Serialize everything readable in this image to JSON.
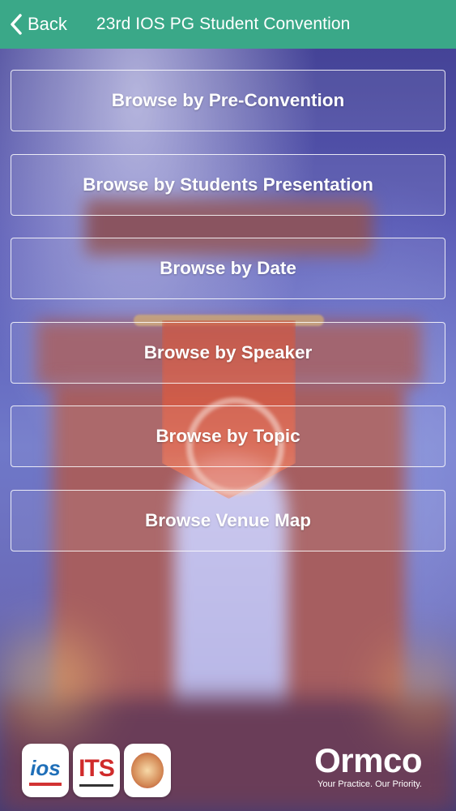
{
  "header": {
    "back_label": "Back",
    "title": "23rd IOS PG Student Convention"
  },
  "menu": {
    "items": [
      {
        "label": "Browse by Pre-Convention"
      },
      {
        "label": "Browse by Students Presentation"
      },
      {
        "label": "Browse by Date"
      },
      {
        "label": "Browse by Speaker"
      },
      {
        "label": "Browse by Topic"
      },
      {
        "label": "Browse Venue Map"
      }
    ]
  },
  "footer": {
    "logos": [
      {
        "text": "ios"
      },
      {
        "text": "ITS"
      },
      {
        "text": ""
      }
    ],
    "sponsor": {
      "name": "Ormco",
      "tagline": "Your Practice. Our Priority."
    }
  },
  "colors": {
    "header_bg": "#3aa888",
    "button_border": "#ffffff"
  }
}
